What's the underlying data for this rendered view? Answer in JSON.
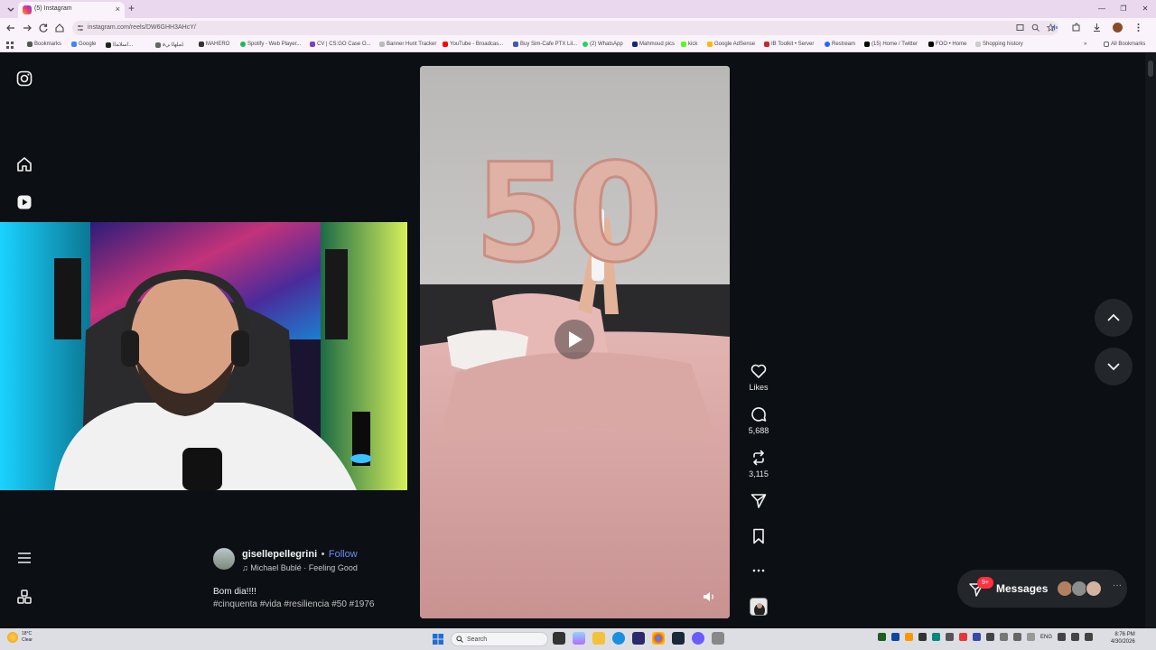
{
  "browser": {
    "tab_title": "(5) Instagram",
    "url": "instagram.com/reels/DW6GHH3AHcY/",
    "bookmarks": [
      "Bookmarks",
      "Google",
      "ﺍﺳﻠﺎﻤﻟﺍ...",
      "ﺎﻤﻠﻬﻟﺍ ﻲﻓ",
      "MAHERO",
      "Spotify - Web Player...",
      "CV | CS:GO Case O...",
      "Banner Hunt Tracker",
      "YouTube - Broadcas...",
      "Buy Sim-Cafe PTX Lil...",
      "(2) WhatsApp",
      "Mahmoud pics",
      "kick",
      "Google AdSense",
      "IB Toolkit • Server",
      "Restream",
      "(15) Home / Twitter",
      "FOO • Home",
      "Shopping history"
    ],
    "all_bookmarks": "All Bookmarks"
  },
  "reel": {
    "username": "gisellepellegrini",
    "separator": "•",
    "follow_label": "Follow",
    "audio": "Michael Bublé · Feeling Good",
    "caption": "Bom dia!!!!",
    "hashtags": "#cinquenta #vida #resiliencia #50 #1976",
    "balloon_text": "50",
    "actions": {
      "likes_label": "Likes",
      "comments_count": "5,688",
      "reposts_count": "3,115"
    }
  },
  "messages": {
    "label": "Messages",
    "badge": "9+"
  },
  "taskbar": {
    "weather_temp": "18°C",
    "weather_desc": "Clear",
    "search_label": "Search",
    "lang": "ENG",
    "time": "8:76 PM",
    "date": "4/30/2026"
  },
  "colors": {
    "page_bg": "#0c0f14",
    "accent_follow": "#6c8cf6",
    "badge": "#ff3040"
  }
}
